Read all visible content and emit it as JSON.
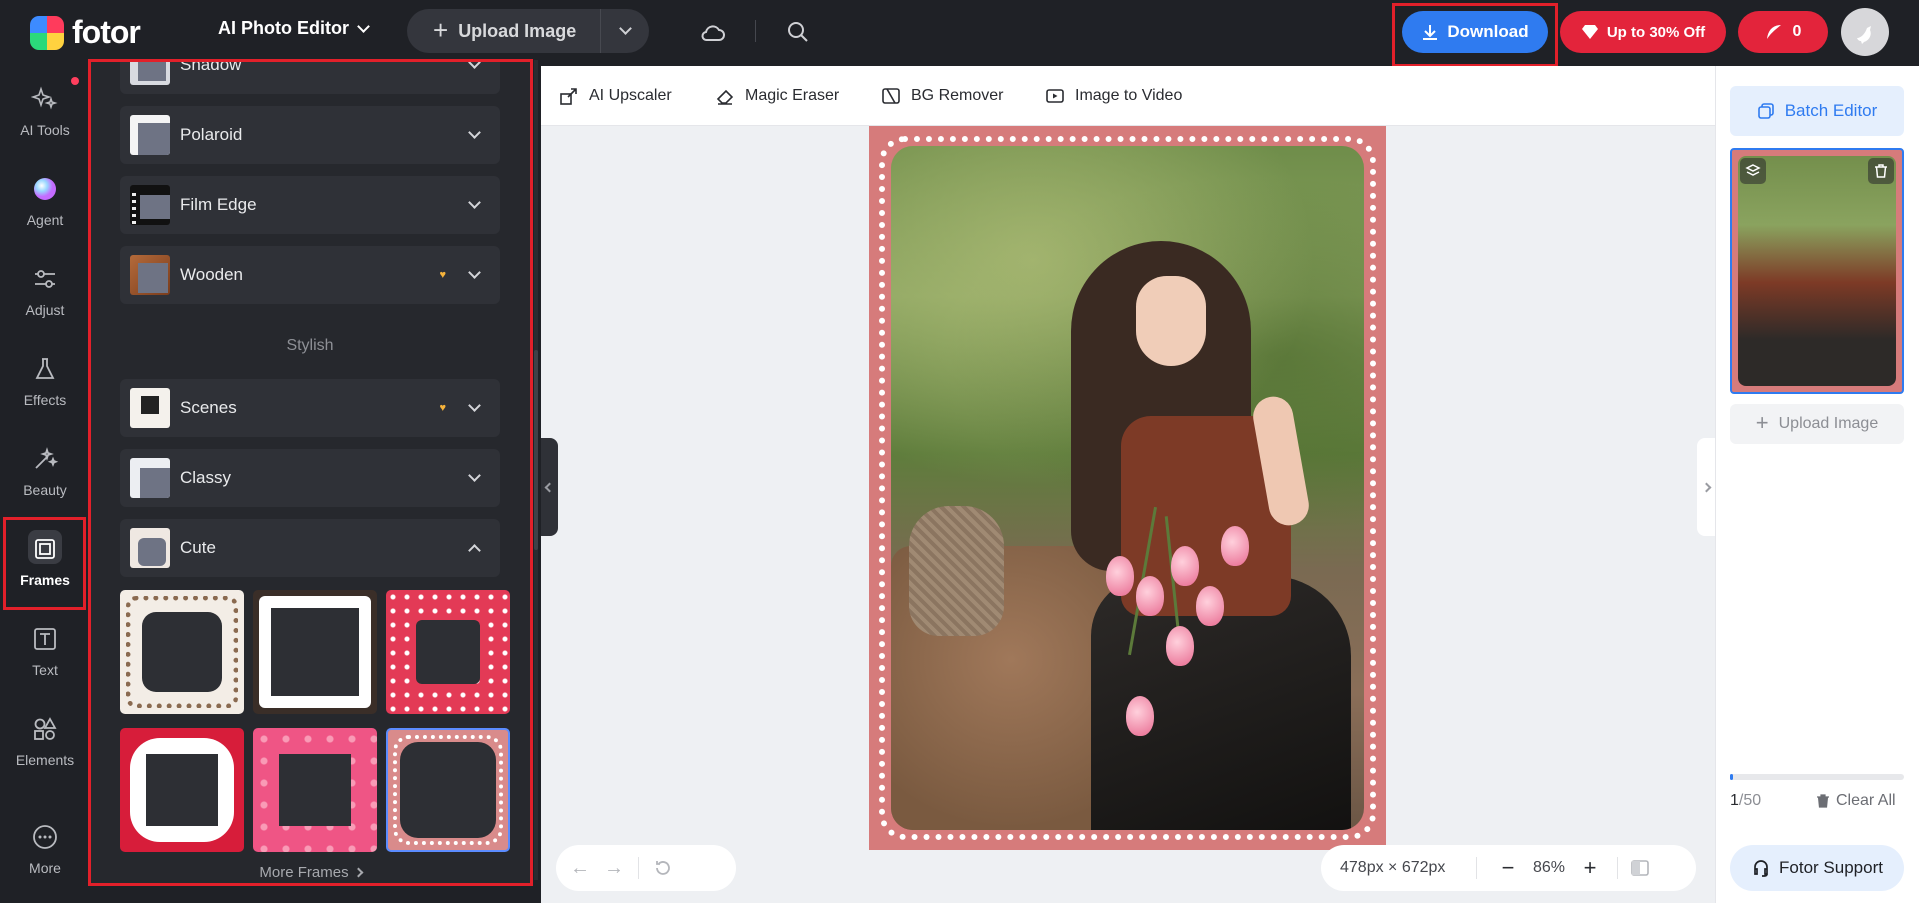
{
  "topbar": {
    "logo_text": "fotor",
    "app_menu_label": "AI Photo Editor",
    "upload_label": "Upload Image",
    "download_label": "Download",
    "promo_label": "Up to 30% Off",
    "credits_count": "0"
  },
  "rail": {
    "items": [
      {
        "label": "AI Tools",
        "icon": "sparkle-icon"
      },
      {
        "label": "Agent",
        "icon": "color-orb-icon"
      },
      {
        "label": "Adjust",
        "icon": "sliders-icon"
      },
      {
        "label": "Effects",
        "icon": "flask-icon"
      },
      {
        "label": "Beauty",
        "icon": "magic-wand-icon"
      },
      {
        "label": "Frames",
        "icon": "frame-icon"
      },
      {
        "label": "Text",
        "icon": "text-icon"
      },
      {
        "label": "Elements",
        "icon": "shapes-icon"
      },
      {
        "label": "More",
        "icon": "more-icon"
      }
    ]
  },
  "frames_panel": {
    "partial_top_label": "Shadow",
    "categories": [
      {
        "label": "Polaroid",
        "premium": false
      },
      {
        "label": "Film Edge",
        "premium": false
      },
      {
        "label": "Wooden",
        "premium": true
      }
    ],
    "section_stylish": "Stylish",
    "stylish_categories": [
      {
        "label": "Scenes",
        "premium": true
      },
      {
        "label": "Classy",
        "premium": false
      },
      {
        "label": "Cute",
        "premium": false,
        "expanded": true
      }
    ],
    "more_frames_label": "More Frames"
  },
  "canvas_toolbar": {
    "tools": [
      "AI Upscaler",
      "Magic Eraser",
      "BG Remover",
      "Image to Video"
    ]
  },
  "canvas": {
    "dimensions_label": "478px × 672px",
    "zoom_label": "86%"
  },
  "right_panel": {
    "batch_editor_label": "Batch Editor",
    "upload_label": "Upload Image",
    "count_current": "1",
    "count_total": "/50",
    "progress_fraction": 0.02,
    "clear_all_label": "Clear All",
    "support_label": "Fotor Support"
  },
  "colors": {
    "accent_blue": "#2f7bf0",
    "promo_red": "#e3243b",
    "highlight_red": "#e2202a",
    "frame_pink": "#d67b7b"
  }
}
